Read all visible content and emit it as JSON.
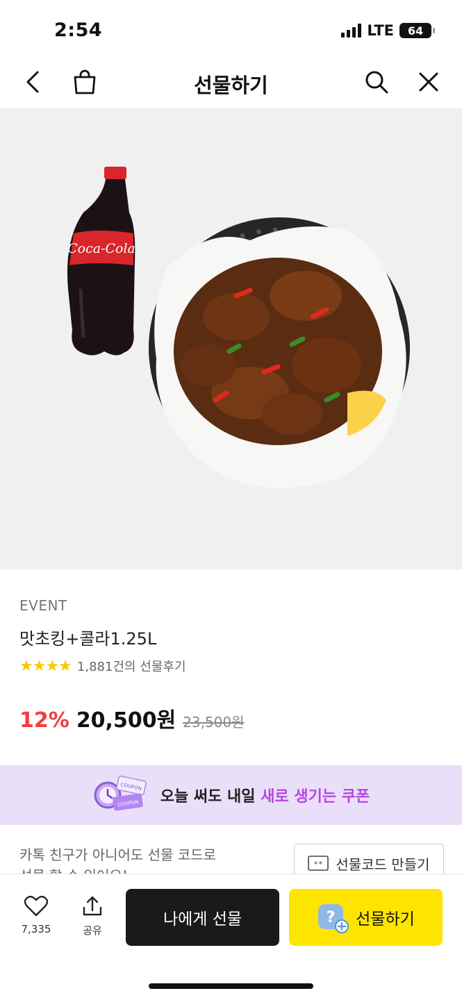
{
  "status_bar": {
    "time": "2:54",
    "network": "LTE",
    "battery": "64"
  },
  "nav": {
    "title": "선물하기",
    "back_icon": "chevron-left-icon",
    "bag_icon": "shopping-bag-icon",
    "search_icon": "search-icon",
    "close_icon": "close-icon"
  },
  "product": {
    "event_label": "EVENT",
    "name": "맛초킹+콜라1.25L",
    "stars": "★★★★",
    "review_count": "1,881건의 선물후기",
    "discount": "12%",
    "price": "20,500원",
    "original_price": "23,500원"
  },
  "coupon_banner": {
    "text_prefix": "오늘 써도 내일",
    "text_highlight": "새로 생기는 쿠폰",
    "coupon_label": "COUPON",
    "highlight_color": "#b647e3"
  },
  "gift_code": {
    "description": "카톡 친구가 아니어도 선물 코드로 선물 할 수 있어요!",
    "button_label": "선물코드 만들기",
    "button_icon": "gift-code-icon"
  },
  "bottom_bar": {
    "like_icon": "heart-icon",
    "like_count": "7,335",
    "share_icon": "share-icon",
    "share_label": "공유",
    "gift_self_label": "나에게 선물",
    "gift_label": "선물하기",
    "gift_icon": "friend-add-icon"
  },
  "colors": {
    "accent_yellow": "#fde500",
    "discount_red": "#f23f3f",
    "banner_bg": "#eadff8"
  }
}
